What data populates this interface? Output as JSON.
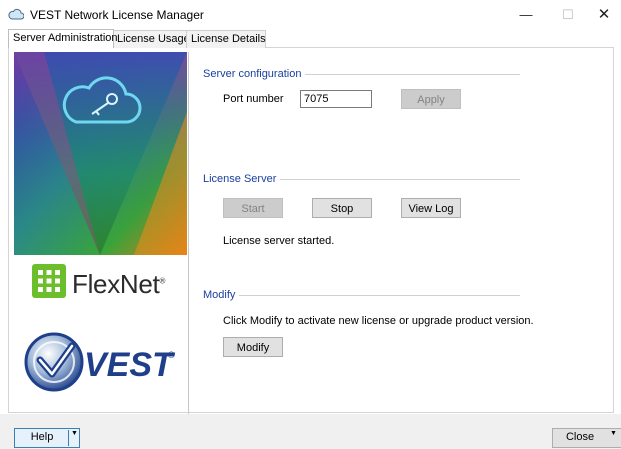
{
  "window": {
    "title": "VEST Network License Manager",
    "minimize_glyph": "—",
    "maximize_glyph": "☐",
    "close_glyph": "✕"
  },
  "tabs": [
    {
      "label": "Server Administration",
      "active": true
    },
    {
      "label": "License Usage",
      "active": false
    },
    {
      "label": "License Details",
      "active": false
    }
  ],
  "left_panel": {
    "graphic_icon": "cloud-key-icon",
    "flexnet_text": "FlexNet",
    "flexnet_mark": "®",
    "vest_text": "VEST",
    "vest_mark": "®"
  },
  "server_configuration": {
    "title": "Server configuration",
    "port_label": "Port number",
    "port_value": "7075",
    "apply_label": "Apply"
  },
  "license_server": {
    "title": "License Server",
    "start_label": "Start",
    "stop_label": "Stop",
    "view_log_label": "View Log",
    "status_text": "License server started."
  },
  "modify": {
    "title": "Modify",
    "description": "Click Modify to activate new license or upgrade product version.",
    "button_label": "Modify"
  },
  "footer": {
    "help_label": "Help",
    "close_label": "Close",
    "dropdown_glyph": "▼"
  },
  "colors": {
    "group_title": "#1a3f9e",
    "accent_blue": "#3c7fb1",
    "flexnet_green": "#6cbf2a"
  }
}
